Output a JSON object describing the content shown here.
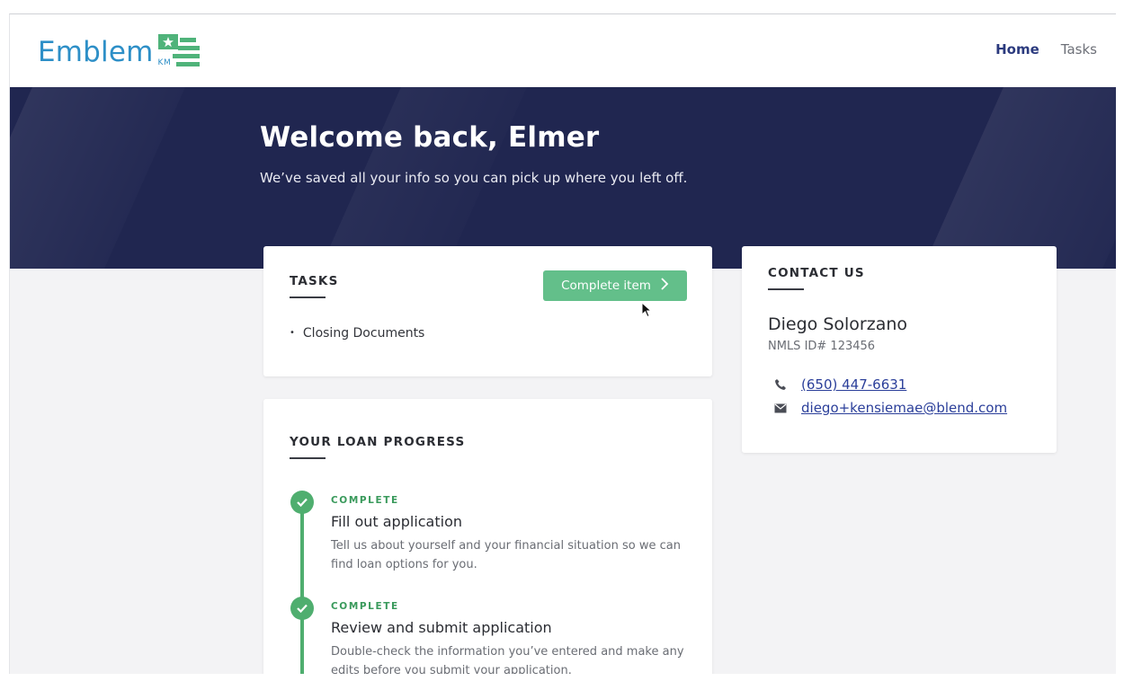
{
  "header": {
    "logo_text": "Emblem",
    "logo_sub": "KM",
    "nav": {
      "home": "Home",
      "tasks": "Tasks"
    }
  },
  "hero": {
    "title": "Welcome back, Elmer",
    "subtitle": "We’ve saved all your info so you can pick up where you left off."
  },
  "tasks": {
    "label": "TASKS",
    "button_label": "Complete item",
    "items": [
      "Closing Documents"
    ]
  },
  "progress": {
    "label": "YOUR LOAN PROGRESS",
    "steps": [
      {
        "status": "COMPLETE",
        "title": "Fill out application",
        "description": "Tell us about yourself and your financial situation so we can find loan options for you."
      },
      {
        "status": "COMPLETE",
        "title": "Review and submit application",
        "description": "Double-check the information you’ve entered and make any edits before you submit your application."
      }
    ]
  },
  "contact": {
    "label": "CONTACT US",
    "name": "Diego Solorzano",
    "nmls": "NMLS ID# 123456",
    "phone": "(650) 447-6631",
    "email": "diego+kensiemae@blend.com"
  },
  "colors": {
    "brand_blue": "#2d8fc7",
    "brand_green": "#63bf8a",
    "hero_navy": "#202650",
    "link": "#2b3f9a"
  },
  "icons": [
    "flag-star-logo-icon",
    "chevron-right-icon",
    "check-icon",
    "phone-icon",
    "mail-icon",
    "cursor-icon"
  ]
}
